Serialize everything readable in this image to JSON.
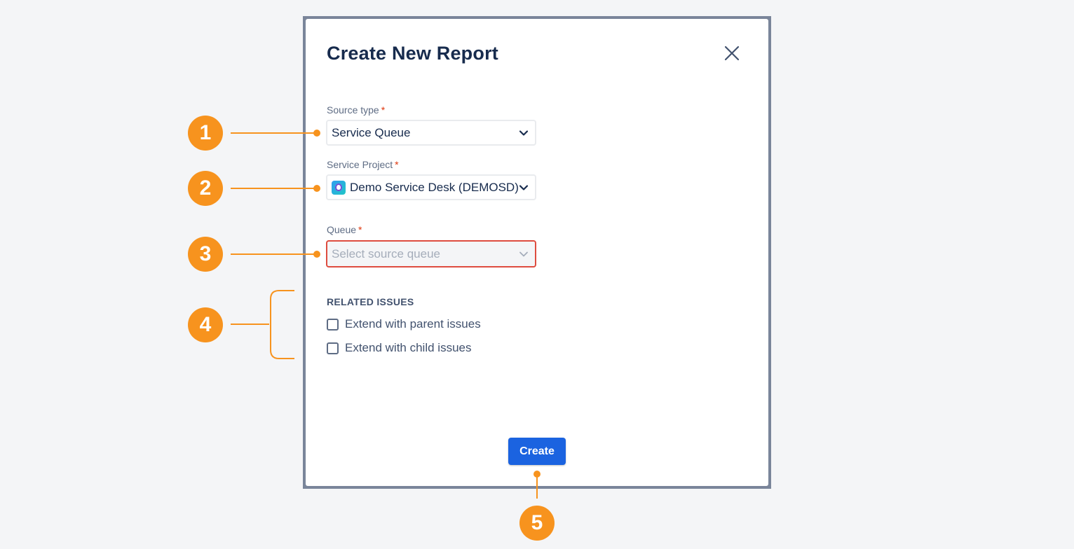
{
  "dialog": {
    "title": "Create New Report",
    "close_icon": "close-icon"
  },
  "fields": {
    "source_type": {
      "label": "Source type",
      "required": "*",
      "value": "Service Queue"
    },
    "service_project": {
      "label": "Service Project",
      "required": "*",
      "value": "Demo Service Desk (DEMOSD)",
      "icon": "project-avatar-icon"
    },
    "queue": {
      "label": "Queue",
      "required": "*",
      "placeholder": "Select source queue"
    }
  },
  "related_issues": {
    "title": "RELATED ISSUES",
    "options": [
      {
        "label": "Extend with parent issues",
        "checked": false
      },
      {
        "label": "Extend with child issues",
        "checked": false
      }
    ]
  },
  "actions": {
    "create_label": "Create"
  },
  "callouts": [
    "1",
    "2",
    "3",
    "4",
    "5"
  ],
  "colors": {
    "accent": "#f7931e",
    "primary_button": "#1b63e0",
    "error_border": "#de4c3f",
    "title_text": "#172b4d"
  }
}
